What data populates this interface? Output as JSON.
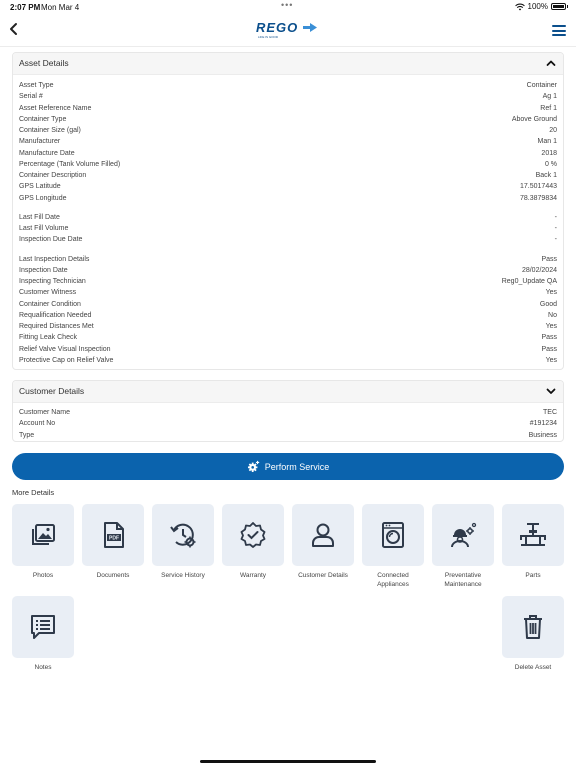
{
  "status_bar": {
    "time": "2:07 PM",
    "date": "Mon Mar 4",
    "battery": "100%",
    "dots": "•••"
  },
  "header": {
    "logo_text": "REGO",
    "logo_tagline": "LIFE IS GOOD"
  },
  "asset_details": {
    "title": "Asset Details",
    "group1": [
      {
        "label": "Asset Type",
        "value": "Container"
      },
      {
        "label": "Serial #",
        "value": "Ag 1"
      },
      {
        "label": "Asset Reference Name",
        "value": "Ref 1"
      },
      {
        "label": "Container Type",
        "value": "Above Ground"
      },
      {
        "label": "Container Size (gal)",
        "value": "20"
      },
      {
        "label": "Manufacturer",
        "value": "Man 1"
      },
      {
        "label": "Manufacture Date",
        "value": "2018"
      },
      {
        "label": "Percentage (Tank Volume Filled)",
        "value": "0 %"
      },
      {
        "label": "Container Description",
        "value": "Back 1"
      },
      {
        "label": "GPS Latitude",
        "value": "17.5017443"
      },
      {
        "label": "GPS Longitude",
        "value": "78.3879834"
      }
    ],
    "group2": [
      {
        "label": "Last Fill Date",
        "value": "-"
      },
      {
        "label": "Last Fill Volume",
        "value": "-"
      },
      {
        "label": "Inspection Due Date",
        "value": "-"
      }
    ],
    "group3": [
      {
        "label": "Last Inspection Details",
        "value": "Pass"
      },
      {
        "label": "Inspection Date",
        "value": "28/02/2024"
      },
      {
        "label": "Inspecting Technician",
        "value": "Reg0_Update QA"
      },
      {
        "label": "Customer Witness",
        "value": "Yes"
      },
      {
        "label": "Container Condition",
        "value": "Good"
      },
      {
        "label": "Requalification Needed",
        "value": "No"
      },
      {
        "label": "Required Distances Met",
        "value": "Yes"
      },
      {
        "label": "Fitting Leak Check",
        "value": "Pass"
      },
      {
        "label": "Relief Valve Visual Inspection",
        "value": "Pass"
      },
      {
        "label": "Protective Cap on Relief Valve",
        "value": "Yes"
      }
    ]
  },
  "customer_details": {
    "title": "Customer Details",
    "rows": [
      {
        "label": "Customer Name",
        "value": "TEC"
      },
      {
        "label": "Account No",
        "value": "#191234"
      },
      {
        "label": "Type",
        "value": "Business"
      }
    ]
  },
  "perform_service": {
    "label": "Perform Service"
  },
  "more_details": {
    "title": "More Details",
    "tiles": [
      {
        "label": "Photos",
        "icon": "photos-icon"
      },
      {
        "label": "Documents",
        "icon": "pdf-document-icon"
      },
      {
        "label": "Service History",
        "icon": "history-gear-icon"
      },
      {
        "label": "Warranty",
        "icon": "warranty-badge-icon"
      },
      {
        "label": "Customer Details",
        "icon": "person-icon"
      },
      {
        "label": "Connected Appliances",
        "icon": "washing-machine-icon"
      },
      {
        "label": "Preventative Maintenance",
        "icon": "worker-gears-icon"
      },
      {
        "label": "Parts",
        "icon": "pipe-valve-icon"
      },
      {
        "label": "Notes",
        "icon": "notes-icon"
      },
      {
        "label": "Delete Asset",
        "icon": "trash-icon"
      }
    ]
  },
  "colors": {
    "primary": "#0b63ad",
    "tile_bg": "#e9eef5",
    "icon": "#2f3a4a"
  }
}
